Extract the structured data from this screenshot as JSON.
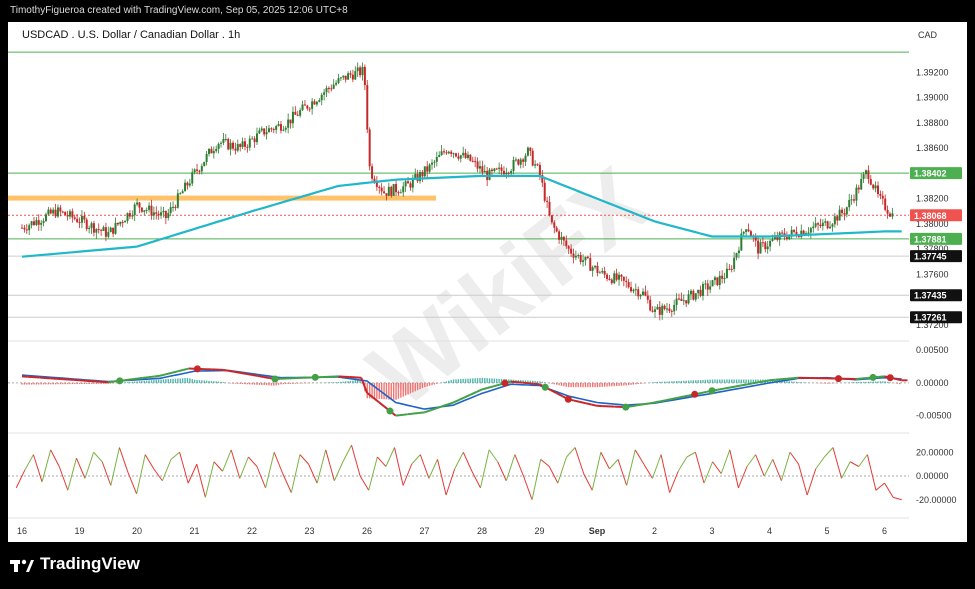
{
  "header": {
    "credit": "TimothyFigueroa created with TradingView.com, Sep 05, 2025 12:06 UTC+8"
  },
  "footer": {
    "brand": "TradingView"
  },
  "watermark": {
    "text": "WikiFX"
  },
  "colors": {
    "up": "#26a69a",
    "down": "#ef5350",
    "candle": "#2e7d32",
    "candle_down": "#c62828",
    "ma": "#1fb7c9",
    "level_green": "#4caf50",
    "orange_zone": "#ffb74d",
    "macd_fast": "#43a047",
    "macd_slow": "#1e63c8",
    "osc": "#e53935",
    "osc_up": "#7cb342"
  },
  "chart_data": [
    {
      "type": "line",
      "name": "price",
      "title": "USDCAD . U.S. Dollar / Canadian Dollar . 1h",
      "currency": "CAD",
      "x_ticks": [
        "16",
        "19",
        "20",
        "21",
        "22",
        "23",
        "26",
        "27",
        "28",
        "29",
        "Sep",
        "2",
        "3",
        "4",
        "5",
        "6"
      ],
      "y_ticks": [
        1.372,
        1.376,
        1.378,
        1.38,
        1.382,
        1.384,
        1.386,
        1.388,
        1.39,
        1.392
      ],
      "y_tick_labels": [
        "1.37200",
        "1.37600",
        "1.37800",
        "1.38000",
        "1.38200",
        "1.38400",
        "1.38600",
        "1.38800",
        "1.39000",
        "1.39200"
      ],
      "ylim": [
        1.3712,
        1.3944
      ],
      "close_path": [
        [
          0,
          1.3797
        ],
        [
          0.6,
          1.381
        ],
        [
          1.0,
          1.3803
        ],
        [
          1.5,
          1.3792
        ],
        [
          2.0,
          1.3815
        ],
        [
          2.5,
          1.3805
        ],
        [
          3.0,
          1.384
        ],
        [
          3.4,
          1.3865
        ],
        [
          3.8,
          1.386
        ],
        [
          4.2,
          1.3873
        ],
        [
          4.6,
          1.388
        ],
        [
          5.0,
          1.3895
        ],
        [
          5.4,
          1.391
        ],
        [
          5.7,
          1.3918
        ],
        [
          5.95,
          1.3921
        ],
        [
          6.05,
          1.3842
        ],
        [
          6.3,
          1.3825
        ],
        [
          6.7,
          1.383
        ],
        [
          7.1,
          1.3845
        ],
        [
          7.4,
          1.386
        ],
        [
          7.8,
          1.385
        ],
        [
          8.1,
          1.3838
        ],
        [
          8.5,
          1.3845
        ],
        [
          8.8,
          1.3857
        ],
        [
          9.0,
          1.384
        ],
        [
          9.2,
          1.38
        ],
        [
          9.5,
          1.378
        ],
        [
          9.8,
          1.377
        ],
        [
          10.1,
          1.376
        ],
        [
          10.4,
          1.3755
        ],
        [
          10.8,
          1.3745
        ],
        [
          11.0,
          1.373
        ],
        [
          11.3,
          1.3735
        ],
        [
          11.6,
          1.3742
        ],
        [
          12.0,
          1.3752
        ],
        [
          12.3,
          1.3762
        ],
        [
          12.6,
          1.38
        ],
        [
          12.8,
          1.378
        ],
        [
          13.2,
          1.379
        ],
        [
          13.6,
          1.3795
        ],
        [
          14.0,
          1.38
        ],
        [
          14.3,
          1.381
        ],
        [
          14.5,
          1.3825
        ],
        [
          14.7,
          1.3842
        ],
        [
          14.9,
          1.382
        ],
        [
          15.1,
          1.3809
        ],
        [
          15.15,
          1.38068
        ]
      ],
      "ma_path": [
        [
          0,
          1.3774
        ],
        [
          2,
          1.3782
        ],
        [
          4,
          1.381
        ],
        [
          5.5,
          1.383
        ],
        [
          6.5,
          1.3835
        ],
        [
          8,
          1.3838
        ],
        [
          9,
          1.3838
        ],
        [
          10,
          1.382
        ],
        [
          11,
          1.3802
        ],
        [
          12,
          1.379
        ],
        [
          13,
          1.379
        ],
        [
          14,
          1.3792
        ],
        [
          15.0,
          1.3794
        ],
        [
          15.3,
          1.3794
        ]
      ],
      "levels": [
        {
          "label": "1.38402",
          "value": 1.38402,
          "color": "#4caf50",
          "style": "solid"
        },
        {
          "label": "1.38068",
          "value": 1.38068,
          "color": "#ef5350",
          "style": "dotted"
        },
        {
          "label": "1.37881",
          "value": 1.37881,
          "color": "#4caf50",
          "style": "solid"
        },
        {
          "label": "1.37745",
          "value": 1.37745,
          "color": "#cccccc",
          "style": "solid"
        },
        {
          "label": "1.37435",
          "value": 1.37435,
          "color": "#cccccc",
          "style": "solid"
        },
        {
          "label": "1.37261",
          "value": 1.37261,
          "color": "#cccccc",
          "style": "solid"
        }
      ],
      "top_line": 1.3936,
      "orange_zone": {
        "value": 1.382,
        "x_end": 7.2
      }
    },
    {
      "type": "line",
      "name": "macd",
      "y_ticks": [
        0.005,
        0,
        -0.005
      ],
      "y_tick_labels": [
        "0.00500",
        "0.00000",
        "-0.00500"
      ],
      "ylim": [
        -0.0072,
        0.0058
      ],
      "fast_path": [
        [
          0,
          0.001
        ],
        [
          1.5,
          0.0001
        ],
        [
          2.4,
          0.0011
        ],
        [
          2.9,
          0.0022
        ],
        [
          3.5,
          0.002
        ],
        [
          4.4,
          0.0006
        ],
        [
          5.5,
          0.001
        ],
        [
          5.9,
          0.0008
        ],
        [
          6.0,
          -0.0015
        ],
        [
          6.5,
          -0.005
        ],
        [
          7.0,
          -0.0045
        ],
        [
          7.5,
          -0.003
        ],
        [
          8.0,
          -0.001
        ],
        [
          8.5,
          0.0002
        ],
        [
          9.0,
          -0.0002
        ],
        [
          9.5,
          -0.0025
        ],
        [
          10.0,
          -0.0035
        ],
        [
          10.5,
          -0.0037
        ],
        [
          11.0,
          -0.003
        ],
        [
          12.0,
          -0.0012
        ],
        [
          13.0,
          0.0004
        ],
        [
          13.5,
          0.0008
        ],
        [
          14.0,
          0.0007
        ],
        [
          14.5,
          0.0006
        ],
        [
          15.0,
          0.001
        ],
        [
          15.3,
          0.0004
        ]
      ],
      "slow_path": [
        [
          0,
          0.0012
        ],
        [
          1.5,
          0.0002
        ],
        [
          2.4,
          0.0007
        ],
        [
          3.0,
          0.0018
        ],
        [
          3.6,
          0.0019
        ],
        [
          4.5,
          0.0008
        ],
        [
          5.5,
          0.0009
        ],
        [
          6.0,
          0.0003
        ],
        [
          6.5,
          -0.003
        ],
        [
          7.0,
          -0.004
        ],
        [
          7.5,
          -0.0034
        ],
        [
          8.0,
          -0.0016
        ],
        [
          8.5,
          -0.0002
        ],
        [
          9.0,
          -0.0004
        ],
        [
          9.5,
          -0.002
        ],
        [
          10.0,
          -0.003
        ],
        [
          10.5,
          -0.0034
        ],
        [
          11.0,
          -0.0031
        ],
        [
          12.0,
          -0.0016
        ],
        [
          13.0,
          0.0
        ],
        [
          13.5,
          0.0007
        ],
        [
          14.0,
          0.0008
        ],
        [
          14.5,
          0.0005
        ],
        [
          15.0,
          0.0008
        ],
        [
          15.3,
          0.0006
        ]
      ],
      "cross_dots": [
        {
          "x": 1.7,
          "color": "#43a047"
        },
        {
          "x": 3.05,
          "color": "#c62828"
        },
        {
          "x": 4.4,
          "color": "#43a047"
        },
        {
          "x": 5.1,
          "color": "#43a047"
        },
        {
          "x": 6.4,
          "color": "#43a047"
        },
        {
          "x": 8.4,
          "color": "#c62828"
        },
        {
          "x": 9.1,
          "color": "#43a047"
        },
        {
          "x": 9.5,
          "color": "#c62828"
        },
        {
          "x": 10.5,
          "color": "#43a047"
        },
        {
          "x": 11.7,
          "color": "#c62828"
        },
        {
          "x": 12.0,
          "color": "#43a047"
        },
        {
          "x": 14.2,
          "color": "#c62828"
        },
        {
          "x": 14.8,
          "color": "#43a047"
        },
        {
          "x": 15.1,
          "color": "#c62828"
        }
      ]
    },
    {
      "type": "line",
      "name": "oscillator",
      "y_ticks": [
        20,
        0,
        -20
      ],
      "y_tick_labels": [
        "20.00000",
        "0.00000",
        "-20.00000"
      ],
      "ylim": [
        -32,
        32
      ],
      "values": [
        -10,
        5,
        18,
        -5,
        22,
        8,
        -12,
        15,
        -2,
        20,
        12,
        -8,
        24,
        3,
        -15,
        18,
        6,
        -4,
        14,
        20,
        -6,
        10,
        -18,
        12,
        4,
        22,
        -2,
        16,
        8,
        -10,
        20,
        2,
        -14,
        18,
        10,
        -6,
        22,
        -4,
        12,
        26,
        0,
        -12,
        16,
        8,
        24,
        -8,
        10,
        18,
        -2,
        14,
        -16,
        6,
        20,
        4,
        -10,
        22,
        12,
        -4,
        18,
        0,
        -20,
        14,
        8,
        -6,
        16,
        24,
        2,
        -12,
        20,
        6,
        14,
        -8,
        22,
        10,
        -2,
        18,
        -14,
        4,
        16,
        20,
        -6,
        12,
        2,
        22,
        -10,
        8,
        18,
        0,
        14,
        -4,
        20,
        10,
        -16,
        6,
        16,
        24,
        -2,
        12,
        8,
        18,
        -12,
        -6,
        -18,
        -20
      ]
    }
  ]
}
